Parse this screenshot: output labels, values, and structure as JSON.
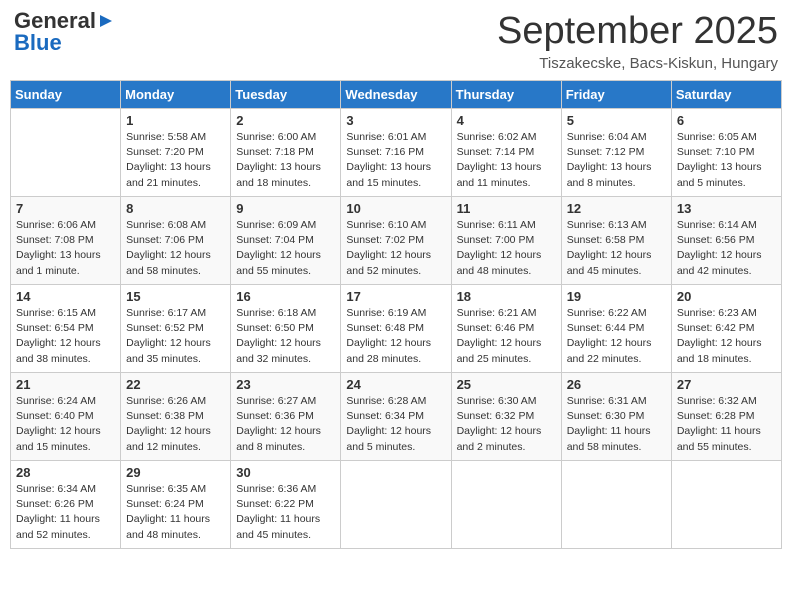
{
  "logo": {
    "general": "General",
    "blue": "Blue"
  },
  "title": "September 2025",
  "location": "Tiszakecske, Bacs-Kiskun, Hungary",
  "days_of_week": [
    "Sunday",
    "Monday",
    "Tuesday",
    "Wednesday",
    "Thursday",
    "Friday",
    "Saturday"
  ],
  "weeks": [
    [
      {
        "day": "",
        "info": ""
      },
      {
        "day": "1",
        "info": "Sunrise: 5:58 AM\nSunset: 7:20 PM\nDaylight: 13 hours and 21 minutes."
      },
      {
        "day": "2",
        "info": "Sunrise: 6:00 AM\nSunset: 7:18 PM\nDaylight: 13 hours and 18 minutes."
      },
      {
        "day": "3",
        "info": "Sunrise: 6:01 AM\nSunset: 7:16 PM\nDaylight: 13 hours and 15 minutes."
      },
      {
        "day": "4",
        "info": "Sunrise: 6:02 AM\nSunset: 7:14 PM\nDaylight: 13 hours and 11 minutes."
      },
      {
        "day": "5",
        "info": "Sunrise: 6:04 AM\nSunset: 7:12 PM\nDaylight: 13 hours and 8 minutes."
      },
      {
        "day": "6",
        "info": "Sunrise: 6:05 AM\nSunset: 7:10 PM\nDaylight: 13 hours and 5 minutes."
      }
    ],
    [
      {
        "day": "7",
        "info": "Sunrise: 6:06 AM\nSunset: 7:08 PM\nDaylight: 13 hours and 1 minute."
      },
      {
        "day": "8",
        "info": "Sunrise: 6:08 AM\nSunset: 7:06 PM\nDaylight: 12 hours and 58 minutes."
      },
      {
        "day": "9",
        "info": "Sunrise: 6:09 AM\nSunset: 7:04 PM\nDaylight: 12 hours and 55 minutes."
      },
      {
        "day": "10",
        "info": "Sunrise: 6:10 AM\nSunset: 7:02 PM\nDaylight: 12 hours and 52 minutes."
      },
      {
        "day": "11",
        "info": "Sunrise: 6:11 AM\nSunset: 7:00 PM\nDaylight: 12 hours and 48 minutes."
      },
      {
        "day": "12",
        "info": "Sunrise: 6:13 AM\nSunset: 6:58 PM\nDaylight: 12 hours and 45 minutes."
      },
      {
        "day": "13",
        "info": "Sunrise: 6:14 AM\nSunset: 6:56 PM\nDaylight: 12 hours and 42 minutes."
      }
    ],
    [
      {
        "day": "14",
        "info": "Sunrise: 6:15 AM\nSunset: 6:54 PM\nDaylight: 12 hours and 38 minutes."
      },
      {
        "day": "15",
        "info": "Sunrise: 6:17 AM\nSunset: 6:52 PM\nDaylight: 12 hours and 35 minutes."
      },
      {
        "day": "16",
        "info": "Sunrise: 6:18 AM\nSunset: 6:50 PM\nDaylight: 12 hours and 32 minutes."
      },
      {
        "day": "17",
        "info": "Sunrise: 6:19 AM\nSunset: 6:48 PM\nDaylight: 12 hours and 28 minutes."
      },
      {
        "day": "18",
        "info": "Sunrise: 6:21 AM\nSunset: 6:46 PM\nDaylight: 12 hours and 25 minutes."
      },
      {
        "day": "19",
        "info": "Sunrise: 6:22 AM\nSunset: 6:44 PM\nDaylight: 12 hours and 22 minutes."
      },
      {
        "day": "20",
        "info": "Sunrise: 6:23 AM\nSunset: 6:42 PM\nDaylight: 12 hours and 18 minutes."
      }
    ],
    [
      {
        "day": "21",
        "info": "Sunrise: 6:24 AM\nSunset: 6:40 PM\nDaylight: 12 hours and 15 minutes."
      },
      {
        "day": "22",
        "info": "Sunrise: 6:26 AM\nSunset: 6:38 PM\nDaylight: 12 hours and 12 minutes."
      },
      {
        "day": "23",
        "info": "Sunrise: 6:27 AM\nSunset: 6:36 PM\nDaylight: 12 hours and 8 minutes."
      },
      {
        "day": "24",
        "info": "Sunrise: 6:28 AM\nSunset: 6:34 PM\nDaylight: 12 hours and 5 minutes."
      },
      {
        "day": "25",
        "info": "Sunrise: 6:30 AM\nSunset: 6:32 PM\nDaylight: 12 hours and 2 minutes."
      },
      {
        "day": "26",
        "info": "Sunrise: 6:31 AM\nSunset: 6:30 PM\nDaylight: 11 hours and 58 minutes."
      },
      {
        "day": "27",
        "info": "Sunrise: 6:32 AM\nSunset: 6:28 PM\nDaylight: 11 hours and 55 minutes."
      }
    ],
    [
      {
        "day": "28",
        "info": "Sunrise: 6:34 AM\nSunset: 6:26 PM\nDaylight: 11 hours and 52 minutes."
      },
      {
        "day": "29",
        "info": "Sunrise: 6:35 AM\nSunset: 6:24 PM\nDaylight: 11 hours and 48 minutes."
      },
      {
        "day": "30",
        "info": "Sunrise: 6:36 AM\nSunset: 6:22 PM\nDaylight: 11 hours and 45 minutes."
      },
      {
        "day": "",
        "info": ""
      },
      {
        "day": "",
        "info": ""
      },
      {
        "day": "",
        "info": ""
      },
      {
        "day": "",
        "info": ""
      }
    ]
  ]
}
